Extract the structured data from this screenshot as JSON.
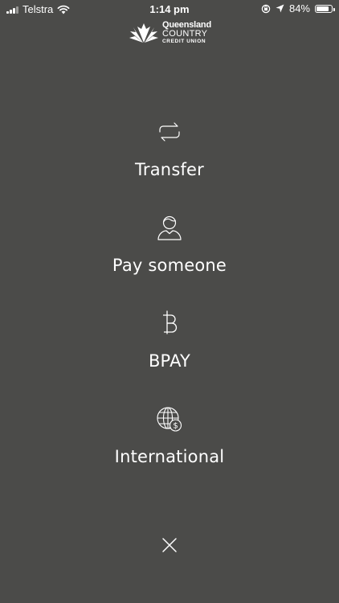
{
  "status_bar": {
    "carrier": "Telstra",
    "time": "1:14 pm",
    "battery": "84%",
    "battery_level": 0.84
  },
  "logo": {
    "line1": "Queensland",
    "line2": "COUNTRY",
    "line3": "CREDIT UNION"
  },
  "menu": {
    "items": [
      {
        "label": "Transfer",
        "icon": "transfer-icon"
      },
      {
        "label": "Pay someone",
        "icon": "person-icon"
      },
      {
        "label": "BPAY",
        "icon": "bpay-icon"
      },
      {
        "label": "International",
        "icon": "globe-dollar-icon"
      }
    ]
  },
  "close_icon": "close-icon",
  "colors": {
    "background": "#4b4b49",
    "foreground": "#ffffff"
  }
}
